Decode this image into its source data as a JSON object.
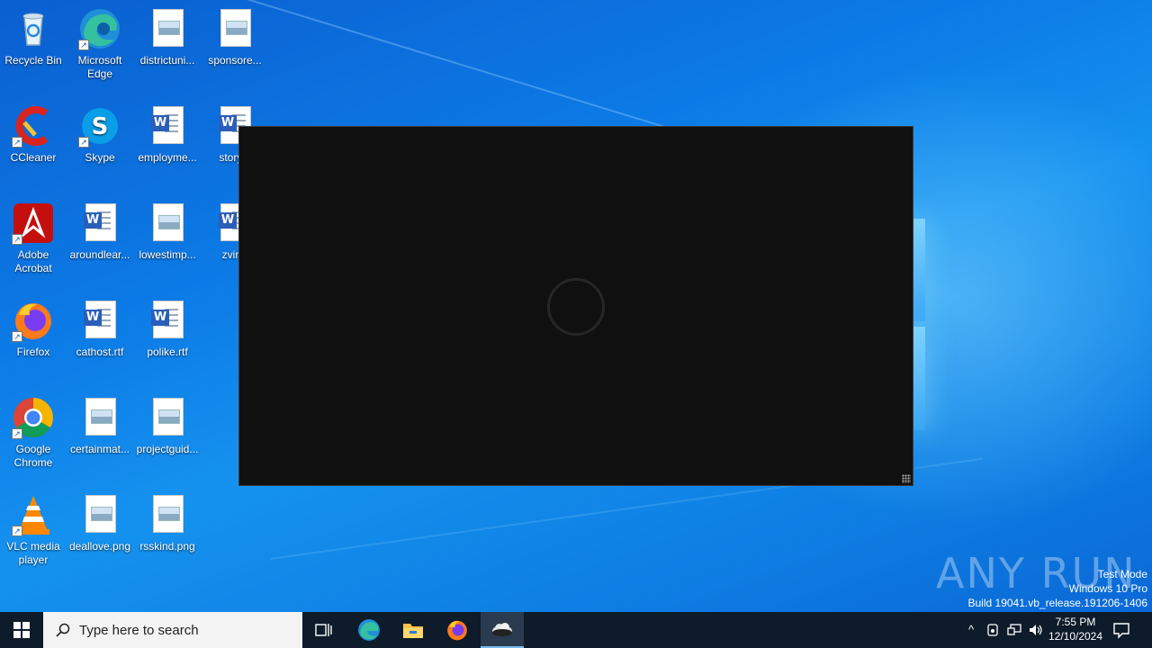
{
  "desktop": {
    "icons": [
      {
        "label": "Recycle Bin",
        "icon": "recycle-bin-icon"
      },
      {
        "label": "Microsoft Edge",
        "icon": "edge-icon"
      },
      {
        "label": "districtuni...",
        "icon": "image-file-icon"
      },
      {
        "label": "sponsore...",
        "icon": "image-file-icon"
      },
      {
        "label": "CCleaner",
        "icon": "ccleaner-icon"
      },
      {
        "label": "Skype",
        "icon": "skype-icon"
      },
      {
        "label": "employme...",
        "icon": "word-doc-icon"
      },
      {
        "label": "storyty",
        "icon": "word-doc-icon"
      },
      {
        "label": "Adobe Acrobat",
        "icon": "acrobat-icon"
      },
      {
        "label": "aroundlear...",
        "icon": "word-doc-icon"
      },
      {
        "label": "lowestimp...",
        "icon": "image-file-icon"
      },
      {
        "label": "zvirtu",
        "icon": "word-doc-icon"
      },
      {
        "label": "Firefox",
        "icon": "firefox-icon"
      },
      {
        "label": "cathost.rtf",
        "icon": "word-doc-icon"
      },
      {
        "label": "polike.rtf",
        "icon": "word-doc-icon"
      },
      {
        "label": "Google Chrome",
        "icon": "chrome-icon"
      },
      {
        "label": "certainmat...",
        "icon": "image-file-icon"
      },
      {
        "label": "projectguid...",
        "icon": "image-file-icon"
      },
      {
        "label": "VLC media player",
        "icon": "vlc-icon"
      },
      {
        "label": "deallove.png",
        "icon": "image-file-icon"
      },
      {
        "label": "rsskind.png",
        "icon": "image-file-icon"
      }
    ]
  },
  "app_window": {
    "state": "loading",
    "spinner_icon": "loading-spinner-icon"
  },
  "watermark": {
    "text": "ANY RUN"
  },
  "system_info": {
    "line1": "Test Mode",
    "line2": "Windows 10 Pro",
    "line3": "Build 19041.vb_release.191206-1406"
  },
  "taskbar": {
    "search_placeholder": "Type here to search",
    "pinned": [
      "task-view-icon",
      "edge-icon",
      "file-explorer-icon",
      "firefox-icon",
      "cloud-app-icon"
    ],
    "clock": {
      "time": "7:55 PM",
      "date": "12/10/2024"
    }
  },
  "colors": {
    "taskbar": "#0d1b2a",
    "wallpaper": "#0c7be6",
    "window": "#101010",
    "accent": "#76b9ed"
  }
}
